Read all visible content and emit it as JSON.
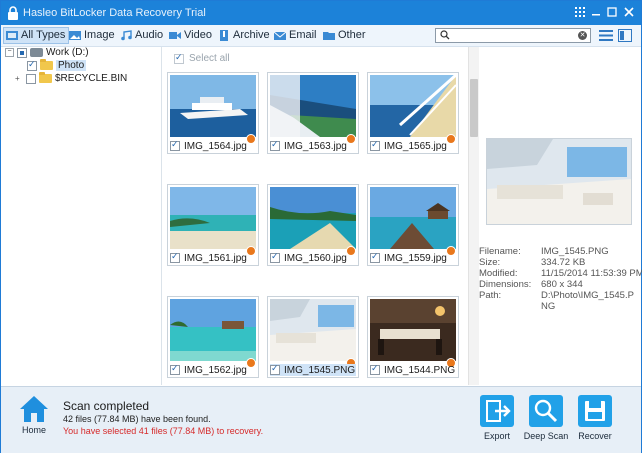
{
  "window": {
    "title": "Hasleo BitLocker Data Recovery Trial",
    "accent": "#1c82d9"
  },
  "titlebar_buttons": [
    "grid-icon",
    "minimize-icon",
    "maximize-icon",
    "close-icon"
  ],
  "filters": [
    {
      "label": "All Types",
      "icon": "all-types-icon",
      "active": true
    },
    {
      "label": "Image",
      "icon": "image-icon"
    },
    {
      "label": "Audio",
      "icon": "audio-icon"
    },
    {
      "label": "Video",
      "icon": "video-icon"
    },
    {
      "label": "Archive",
      "icon": "archive-icon"
    },
    {
      "label": "Email",
      "icon": "email-icon"
    },
    {
      "label": "Other",
      "icon": "folder-icon"
    }
  ],
  "search": {
    "value": "",
    "placeholder": ""
  },
  "tree": {
    "root": "Work (D:)",
    "children": [
      {
        "label": "Photo",
        "checked": true,
        "selected": true
      },
      {
        "label": "$RECYCLE.BIN",
        "checked": false
      }
    ]
  },
  "grid": {
    "select_all": "Select all",
    "items": [
      {
        "name": "IMG_1564.jpg",
        "checked": true
      },
      {
        "name": "IMG_1563.jpg",
        "checked": true
      },
      {
        "name": "IMG_1565.jpg",
        "checked": true
      },
      {
        "name": "IMG_1561.jpg",
        "checked": true
      },
      {
        "name": "IMG_1560.jpg",
        "checked": true
      },
      {
        "name": "IMG_1559.jpg",
        "checked": true
      },
      {
        "name": "IMG_1562.jpg",
        "checked": true
      },
      {
        "name": "IMG_1545.PNG",
        "checked": true,
        "selected": true
      },
      {
        "name": "IMG_1544.PNG",
        "checked": true
      }
    ]
  },
  "preview": {
    "meta": [
      {
        "key": "Filename:",
        "value": "IMG_1545.PNG"
      },
      {
        "key": "Size:",
        "value": "334.72 KB"
      },
      {
        "key": "Modified:",
        "value": "11/15/2014 11:53:39 PM"
      },
      {
        "key": "Dimensions:",
        "value": "680 x 344"
      },
      {
        "key": "Path:",
        "value": "D:\\Photo\\IMG_1545.P"
      },
      {
        "key": "",
        "value": "NG"
      }
    ]
  },
  "status": {
    "home_label": "Home",
    "title": "Scan completed",
    "found": "42 files (77.84 MB) have been found.",
    "selected": "You have selected 41 files (77.84 MB) to recovery."
  },
  "actions": [
    {
      "label": "Export",
      "icon": "export-icon"
    },
    {
      "label": "Deep Scan",
      "icon": "deep-scan-icon"
    },
    {
      "label": "Recover",
      "icon": "recover-icon"
    }
  ]
}
